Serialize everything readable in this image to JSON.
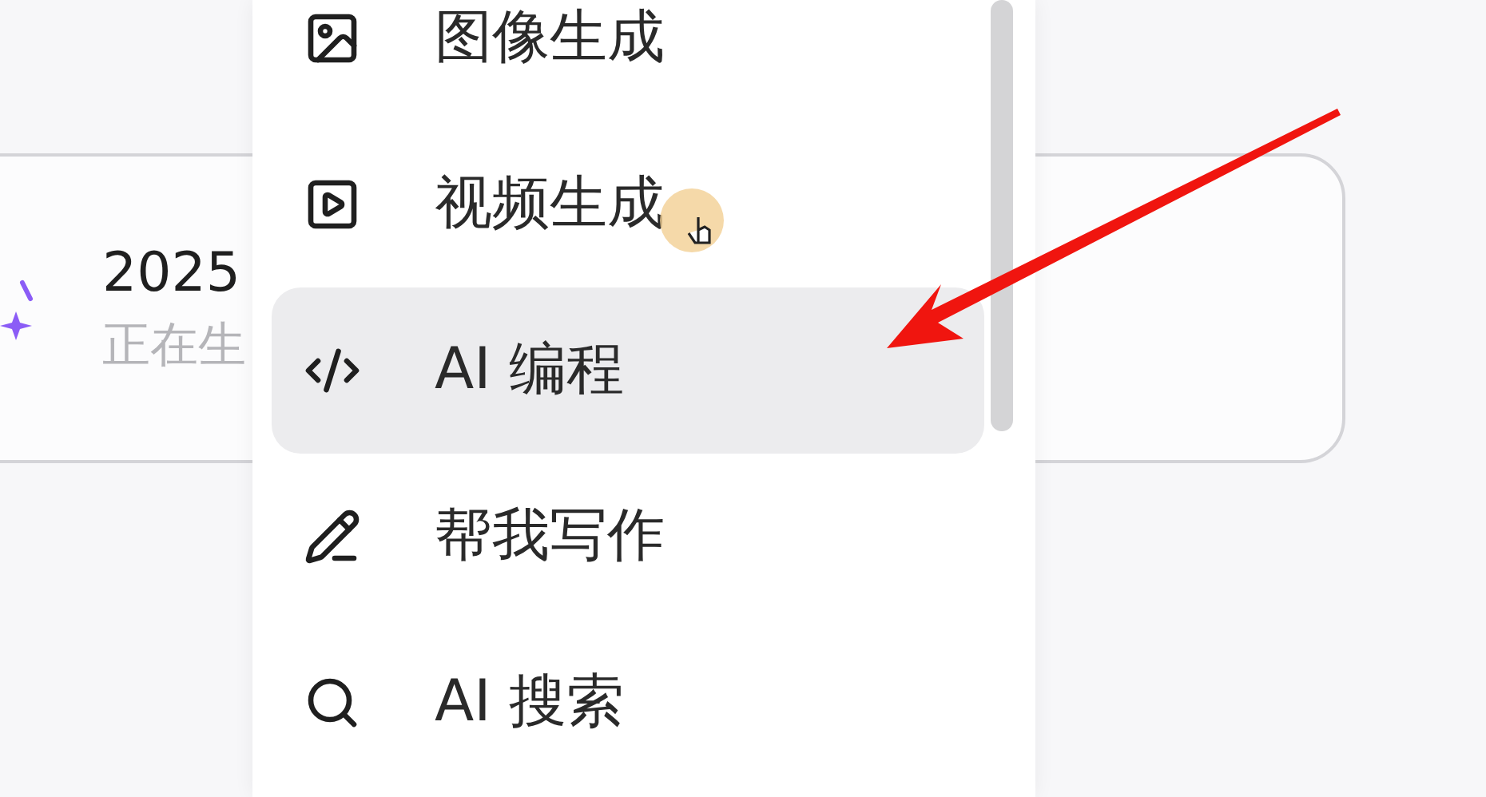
{
  "card": {
    "title": "2025",
    "subtitle": "正在生"
  },
  "menu": {
    "items": [
      {
        "label": "图像生成",
        "selected": false
      },
      {
        "label": "视频生成",
        "selected": false
      },
      {
        "label": "AI 编程",
        "selected": true
      },
      {
        "label": "帮我写作",
        "selected": false
      },
      {
        "label": "AI 搜索",
        "selected": false
      }
    ]
  }
}
